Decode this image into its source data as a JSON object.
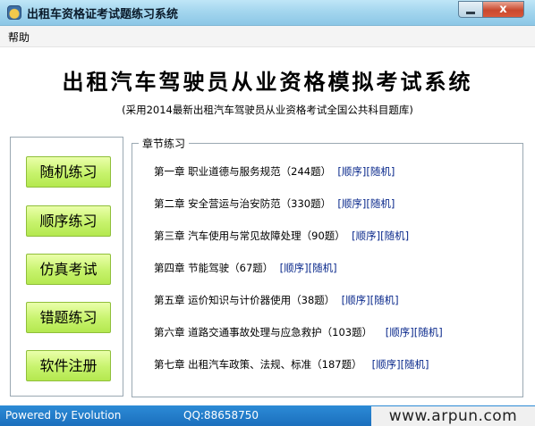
{
  "window": {
    "title": "出租车资格证考试题练习系统",
    "close_glyph": "x"
  },
  "menu": {
    "help": "帮助"
  },
  "header": {
    "title": "出租汽车驾驶员从业资格模拟考试系统",
    "subtitle": "(采用2014最新出租汽车驾驶员从业资格考试全国公共科目题库)"
  },
  "buttons": [
    "随机练习",
    "顺序练习",
    "仿真考试",
    "错题练习",
    "软件注册"
  ],
  "chapter_section": {
    "label": "章节练习",
    "chapters": [
      {
        "title": "第一章  职业道德与服务规范（244题）",
        "seq": "[顺序]",
        "rand": "[随机]"
      },
      {
        "title": "第二章  安全营运与治安防范（330题）",
        "seq": "[顺序]",
        "rand": "[随机]"
      },
      {
        "title": "第三章  汽车使用与常见故障处理（90题）",
        "seq": "[顺序]",
        "rand": "[随机]"
      },
      {
        "title": "第四章  节能驾驶（67题）",
        "seq": "[顺序]",
        "rand": "[随机]"
      },
      {
        "title": "第五章  运价知识与计价器使用（38题）",
        "seq": "[顺序]",
        "rand": "[随机]"
      },
      {
        "title": "第六章  道路交通事故处理与应急救护（103题）",
        "seq": "[顺序]",
        "rand": "[随机]"
      },
      {
        "title": "第七章  出租汽车政策、法规、标准（187题）",
        "seq": "[顺序]",
        "rand": "[随机]"
      }
    ]
  },
  "status": {
    "powered": "Powered by Evolution",
    "qq": "QQ:88658750",
    "watermark": "www.arpun.com"
  }
}
